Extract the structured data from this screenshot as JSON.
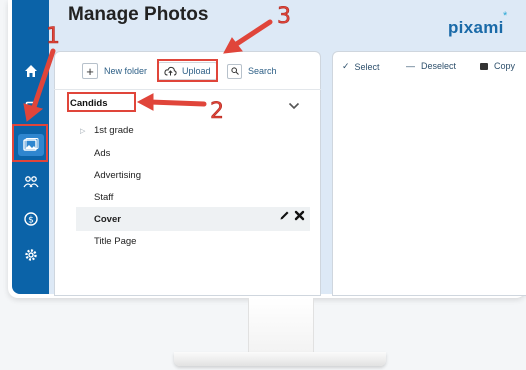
{
  "header": {
    "title": "Manage Photos",
    "logo": "pixami",
    "logo_mark": "*"
  },
  "sidebar": {
    "items": [
      {
        "name": "home-icon"
      },
      {
        "name": "book-icon"
      },
      {
        "name": "photos-icon"
      },
      {
        "name": "people-icon"
      },
      {
        "name": "dollar-icon"
      },
      {
        "name": "gear-icon"
      }
    ]
  },
  "left_toolbar": {
    "new_folder": "New folder",
    "upload": "Upload",
    "search": "Search"
  },
  "folder_select": {
    "value": "Candids"
  },
  "folders": [
    "1st grade",
    "Ads",
    "Advertising",
    "Staff",
    "Cover",
    "Title Page"
  ],
  "right_toolbar": {
    "select": "Select",
    "deselect": "Deselect",
    "copy": "Copy"
  },
  "annotations": {
    "n1": "1",
    "n2": "2",
    "n3": "3",
    "color": "#e0453a"
  }
}
